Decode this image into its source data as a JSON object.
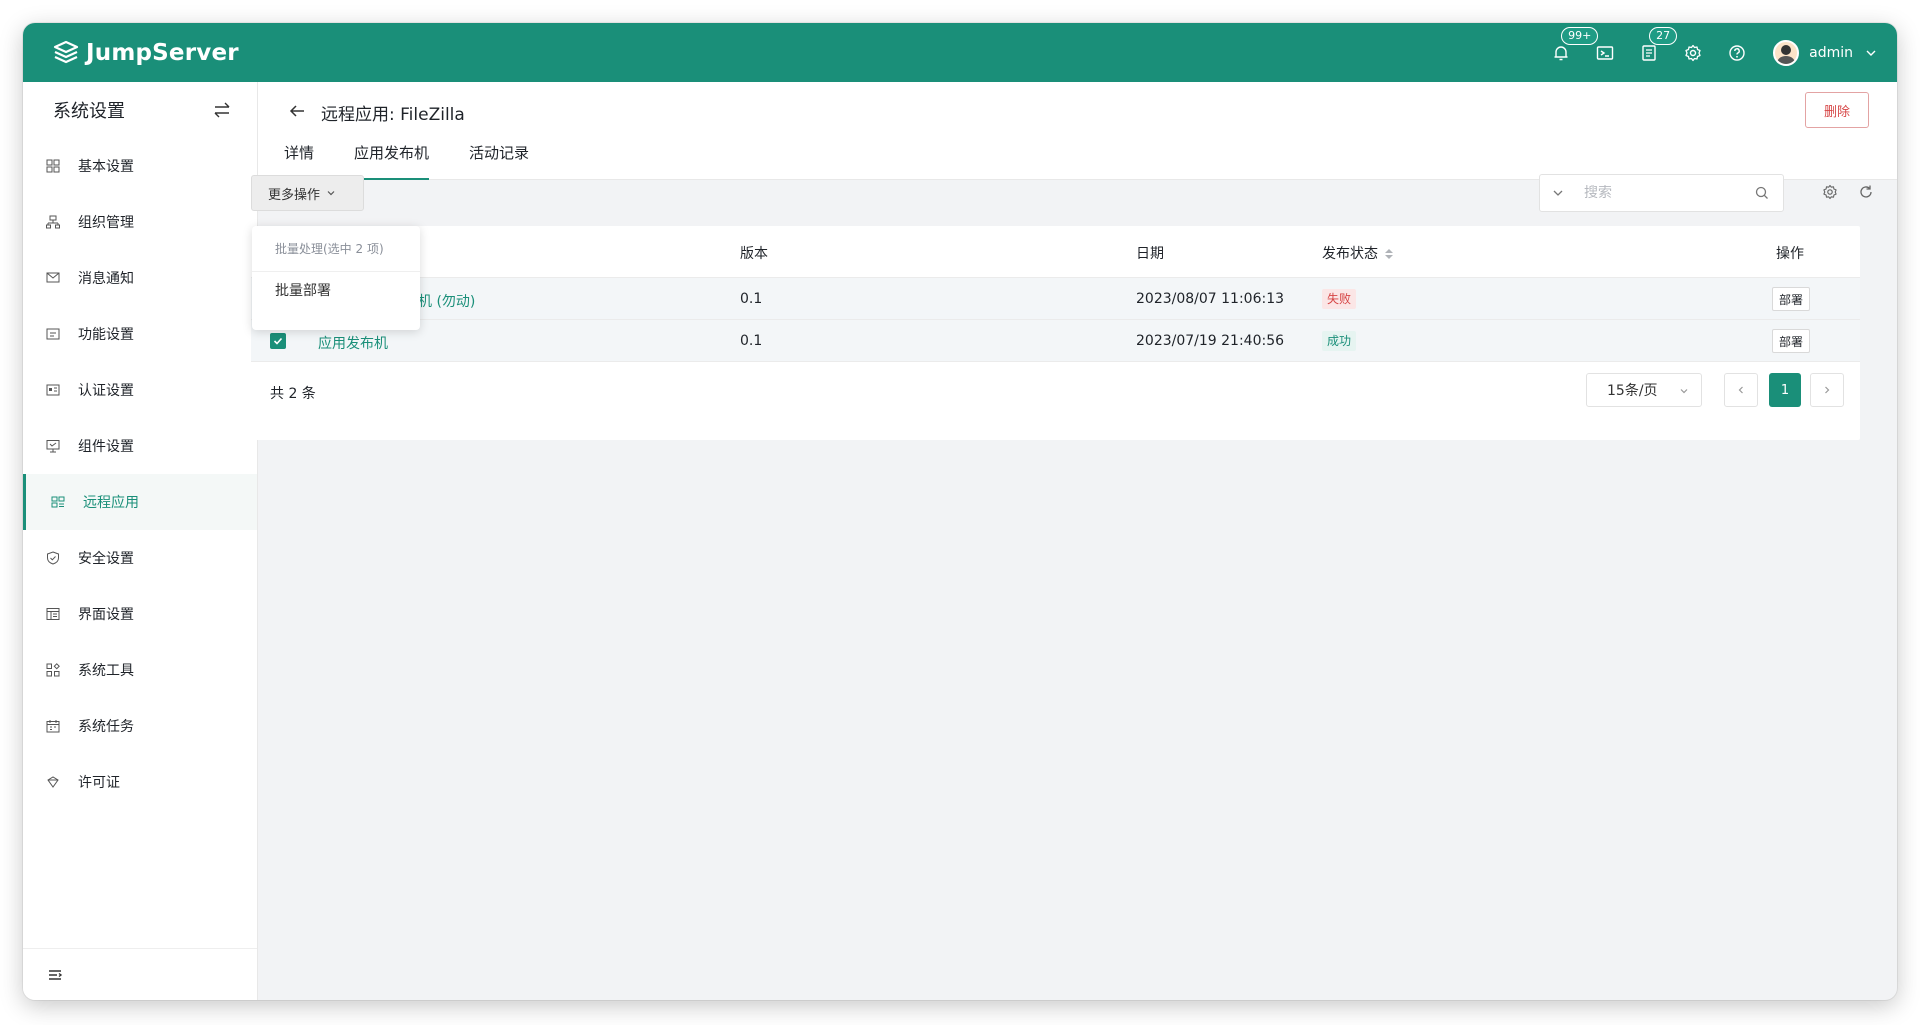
{
  "topbar": {
    "logo_text": "JumpServer",
    "notification_badge": "99+",
    "tickets_badge": "27",
    "user_name": "admin",
    "brand_color": "#1a8f79",
    "icons": [
      "bell-icon",
      "terminal-icon",
      "tickets-icon",
      "settings-icon",
      "help-icon"
    ]
  },
  "sidebar": {
    "title": "系统设置",
    "items": [
      {
        "label": "基本设置",
        "icon": "grid-icon"
      },
      {
        "label": "组织管理",
        "icon": "org-icon"
      },
      {
        "label": "消息通知",
        "icon": "message-icon"
      },
      {
        "label": "功能设置",
        "icon": "feature-icon"
      },
      {
        "label": "认证设置",
        "icon": "id-card-icon"
      },
      {
        "label": "组件设置",
        "icon": "monitor-icon"
      },
      {
        "label": "远程应用",
        "icon": "app-icon",
        "active": true
      },
      {
        "label": "安全设置",
        "icon": "shield-icon"
      },
      {
        "label": "界面设置",
        "icon": "layout-icon"
      },
      {
        "label": "系统工具",
        "icon": "tools-icon"
      },
      {
        "label": "系统任务",
        "icon": "calendar-icon"
      },
      {
        "label": "许可证",
        "icon": "license-icon"
      }
    ]
  },
  "header": {
    "title": "远程应用: FileZilla",
    "delete_label": "删除",
    "tabs": [
      {
        "label": "详情"
      },
      {
        "label": "应用发布机",
        "active": true
      },
      {
        "label": "活动记录"
      }
    ]
  },
  "toolbar": {
    "more_actions_label": "更多操作",
    "search_placeholder": "搜索"
  },
  "dropdown": {
    "header": "批量处理(选中 2 项)",
    "items": [
      "批量部署"
    ]
  },
  "table": {
    "columns": [
      "版本",
      "日期",
      "发布状态",
      "操作"
    ],
    "rows": [
      {
        "name": "机 (勿动)",
        "version": "0.1",
        "date": "2023/08/07 11:06:13",
        "status": "失败",
        "status_type": "fail",
        "action": "部署"
      },
      {
        "name": "应用发布机",
        "version": "0.1",
        "date": "2023/07/19 21:40:56",
        "status": "成功",
        "status_type": "ok",
        "action": "部署"
      }
    ]
  },
  "pagination": {
    "total": "共 2 条",
    "page_size": "15条/页",
    "current_page": "1"
  }
}
